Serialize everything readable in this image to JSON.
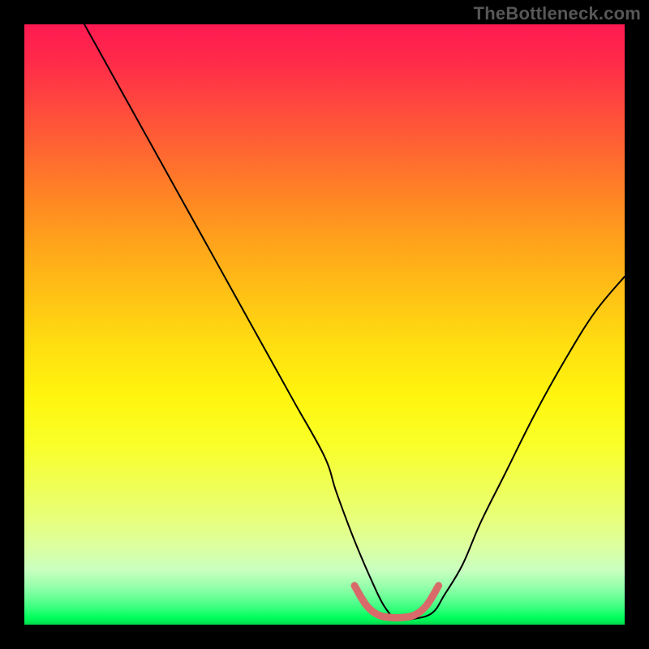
{
  "watermark": "TheBottleneck.com",
  "chart_data": {
    "type": "line",
    "title": "",
    "xlabel": "",
    "ylabel": "",
    "xlim": [
      0,
      100
    ],
    "ylim": [
      0,
      100
    ],
    "grid": false,
    "legend": false,
    "annotations": [],
    "series": [
      {
        "name": "bottleneck-curve",
        "color": "#000000",
        "stroke_width": 2,
        "x": [
          10,
          15,
          20,
          25,
          30,
          35,
          40,
          45,
          50,
          52,
          55,
          58,
          60,
          62,
          65,
          68,
          70,
          73,
          76,
          80,
          85,
          90,
          95,
          100
        ],
        "y": [
          100,
          91,
          82,
          73,
          64,
          55,
          46,
          37,
          28,
          22,
          14,
          7,
          3,
          1,
          1,
          2,
          5,
          10,
          17,
          25,
          35,
          44,
          52,
          58
        ]
      },
      {
        "name": "optimal-band",
        "color": "#d86a6a",
        "stroke_width": 9,
        "x": [
          55,
          57,
          59,
          61,
          63,
          65,
          67,
          69
        ],
        "y": [
          6.5,
          3.2,
          1.6,
          1.2,
          1.2,
          1.6,
          3.2,
          6.5
        ]
      }
    ]
  }
}
